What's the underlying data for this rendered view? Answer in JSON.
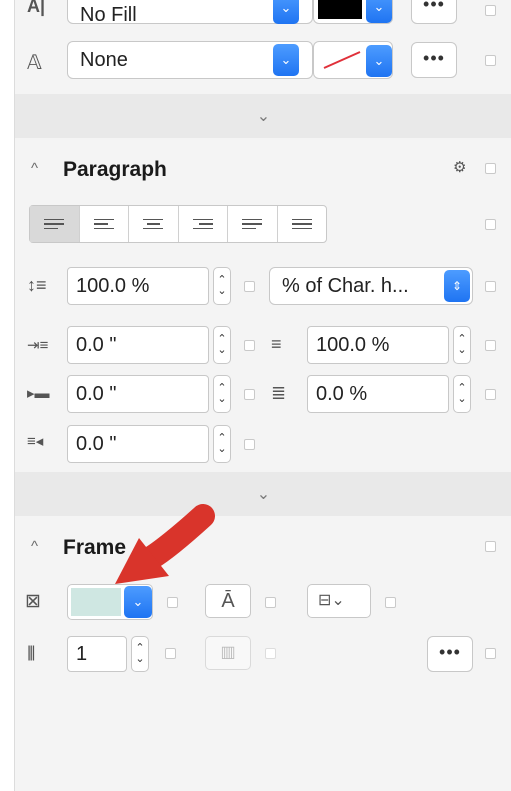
{
  "fill": {
    "fill_value": "No Fill",
    "fill_icon": "text-fill-icon",
    "stroke_value": "None",
    "stroke_icon": "text-stroke-icon",
    "fill_color": "#000000",
    "stroke_color": "none-red-slash",
    "more_label": "•••"
  },
  "paragraph": {
    "title": "Paragraph",
    "alignment_options": [
      "align-justify-left",
      "align-left",
      "align-center",
      "align-right",
      "align-justify",
      "align-justify-all"
    ],
    "selected_alignment": 0,
    "line_spacing": "100.0 %",
    "line_spacing_unit": "% of Char. h...",
    "left_indent": "0.0 \"",
    "first_line_indent": "0.0 \"",
    "right_indent": "0.0 \"",
    "char_width": "100.0 %",
    "spacing_after": "0.0 %"
  },
  "frame": {
    "title": "Frame",
    "fill_color": "#cfe7e2",
    "columns": "1",
    "more_label": "•••"
  },
  "colors": {
    "accent": "#1f74f2",
    "arrow": "#d9342b"
  }
}
